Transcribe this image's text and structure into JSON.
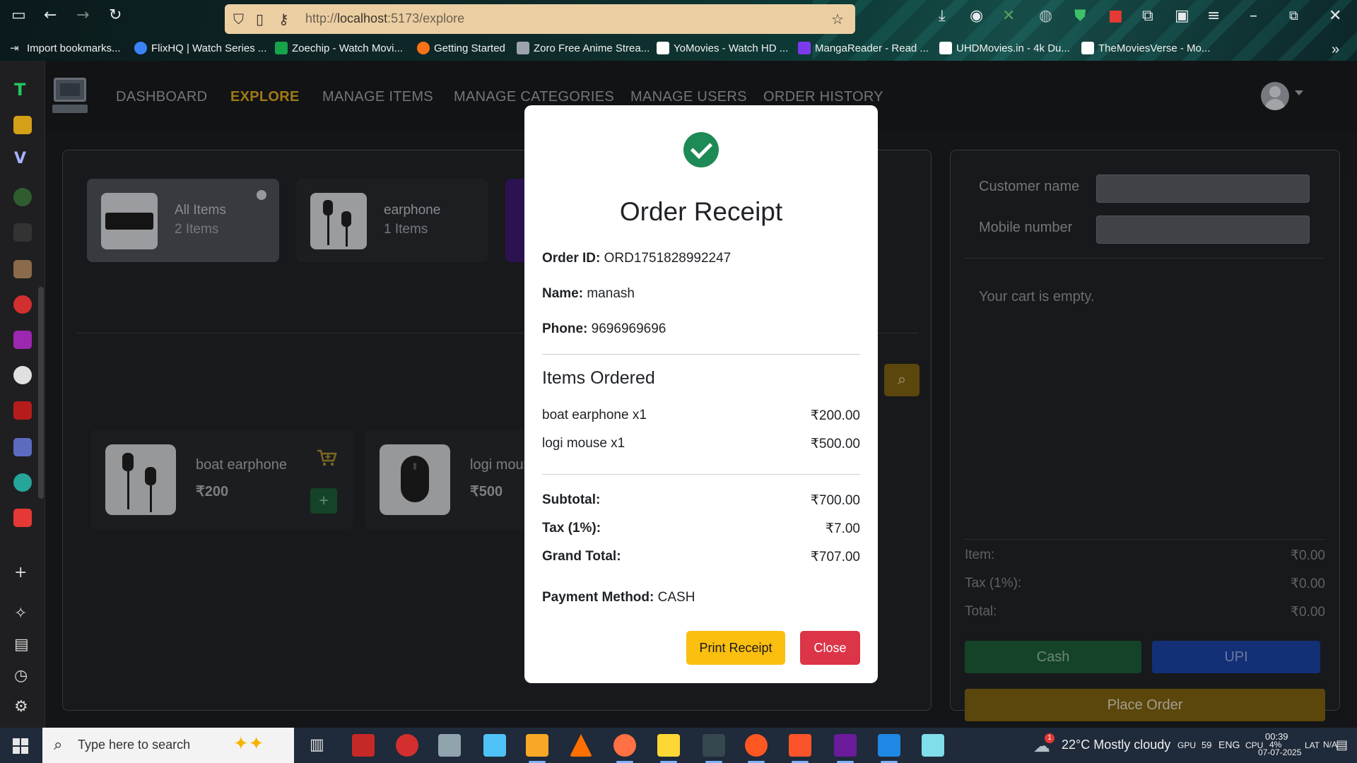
{
  "browser": {
    "url_prefix": "http://",
    "url_host": "localhost",
    "url_rest": ":5173/explore",
    "bookmarks": [
      {
        "label": "Import bookmarks...",
        "color": "#c9d1d9"
      },
      {
        "label": "FlixHQ | Watch Series ...",
        "color": "#3b82f6"
      },
      {
        "label": "Zoechip - Watch Movi...",
        "color": "#16a34a"
      },
      {
        "label": "Getting Started",
        "color": "#f97316"
      },
      {
        "label": "Zoro Free Anime Strea...",
        "color": "#9ca3af"
      },
      {
        "label": "YoMovies - Watch HD ...",
        "color": "#ffffff"
      },
      {
        "label": "MangaReader - Read ...",
        "color": "#7c3aed"
      },
      {
        "label": "UHDMovies.in - 4k Du...",
        "color": "#ffffff"
      },
      {
        "label": "TheMoviesVerse - Mo...",
        "color": "#ffffff"
      }
    ]
  },
  "nav": {
    "links": [
      "DASHBOARD",
      "EXPLORE",
      "MANAGE ITEMS",
      "MANAGE CATEGORIES",
      "MANAGE USERS",
      "ORDER HISTORY"
    ],
    "active": "EXPLORE"
  },
  "categories": [
    {
      "name": "All Items",
      "count": "2 Items"
    },
    {
      "name": "earphone",
      "count": "1 Items"
    }
  ],
  "items": [
    {
      "name": "boat earphone",
      "price": "₹200"
    },
    {
      "name": "logi mouse",
      "price": "₹500"
    }
  ],
  "cart": {
    "customer_label": "Customer name",
    "mobile_label": "Mobile number",
    "empty_text": "Your cart is empty.",
    "item_label": "Item:",
    "item_value": "₹0.00",
    "tax_label": "Tax (1%):",
    "tax_value": "₹0.00",
    "total_label": "Total:",
    "total_value": "₹0.00",
    "cash_label": "Cash",
    "upi_label": "UPI",
    "place_order_label": "Place Order"
  },
  "receipt": {
    "title": "Order Receipt",
    "order_id_label": "Order ID:",
    "order_id": "ORD1751828992247",
    "name_label": "Name:",
    "name": "manash",
    "phone_label": "Phone:",
    "phone": "9696969696",
    "items_heading": "Items Ordered",
    "lines": [
      {
        "desc": "boat earphone x1",
        "amount": "₹200.00"
      },
      {
        "desc": "logi mouse x1",
        "amount": "₹500.00"
      }
    ],
    "subtotal_label": "Subtotal:",
    "subtotal": "₹700.00",
    "tax_label": "Tax (1%):",
    "tax": "₹7.00",
    "grand_total_label": "Grand Total:",
    "grand_total": "₹707.00",
    "payment_label": "Payment Method:",
    "payment": "CASH",
    "print_label": "Print Receipt",
    "close_label": "Close"
  },
  "taskbar": {
    "search_placeholder": "Type here to search",
    "weather": "22°C  Mostly cloudy",
    "gpu": "GPU",
    "gpu_value": "59",
    "lang": "ENG",
    "cpu": "CPU",
    "cpu_value": "4%",
    "time": "00:39",
    "date": "07-07-2025",
    "lat": "LAT",
    "lat_value": "N/A",
    "notification_count": "1"
  },
  "colors": {
    "accent_gold": "#d4a21f",
    "success_green": "#1e8a55",
    "print_yellow": "#fbbf10",
    "close_red": "#dc3548",
    "cash_green": "#1d5a35",
    "upi_blue": "#1a3f9e"
  }
}
